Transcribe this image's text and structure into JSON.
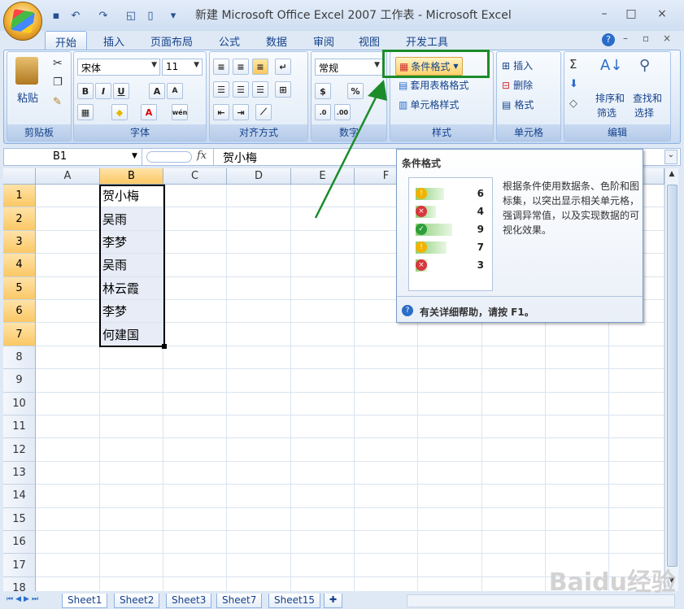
{
  "window": {
    "title": "新建 Microsoft Office Excel 2007 工作表 - Microsoft Excel",
    "controls": [
      "–",
      "□",
      "×"
    ]
  },
  "tabs": [
    {
      "label": "开始",
      "active": true
    },
    {
      "label": "插入"
    },
    {
      "label": "页面布局"
    },
    {
      "label": "公式"
    },
    {
      "label": "数据"
    },
    {
      "label": "审阅"
    },
    {
      "label": "视图"
    },
    {
      "label": "开发工具"
    }
  ],
  "ribbon": {
    "clipboard": {
      "label": "剪贴板",
      "paste": "粘贴"
    },
    "font": {
      "label": "字体",
      "name": "宋体",
      "size": "11"
    },
    "alignment": {
      "label": "对齐方式"
    },
    "number": {
      "label": "数字",
      "format": "常规"
    },
    "styles": {
      "label": "样式",
      "conditional": "条件格式",
      "table": "套用表格格式",
      "cell": "单元格样式"
    },
    "cells": {
      "label": "单元格",
      "insert": "插入",
      "delete": "删除",
      "format": "格式"
    },
    "editing": {
      "label": "编辑",
      "sort1": "排序和",
      "sort2": "筛选",
      "find1": "查找和",
      "find2": "选择"
    }
  },
  "formula_bar": {
    "name_box": "B1",
    "fx": "fx",
    "value": "贺小梅"
  },
  "columns": [
    "A",
    "B",
    "C",
    "D",
    "E",
    "F"
  ],
  "rows": [
    "1",
    "2",
    "3",
    "4",
    "5",
    "6",
    "7",
    "8",
    "9",
    "10",
    "11",
    "12",
    "13",
    "14",
    "15",
    "16",
    "17",
    "18"
  ],
  "cells_b": [
    "贺小梅",
    "吴雨",
    "李梦",
    "吴雨",
    "林云霞",
    "李梦",
    "何建国"
  ],
  "tooltip": {
    "title": "条件格式",
    "description": "根据条件使用数据条、色阶和图标集，以突出显示相关单元格，强调异常值，以及实现数据的可视化效果。",
    "sample_values": [
      "6",
      "4",
      "9",
      "7",
      "3"
    ],
    "help": "有关详细帮助，请按 F1。"
  },
  "sheets": [
    "Sheet1",
    "Sheet2",
    "Sheet3",
    "Sheet7",
    "Sheet15"
  ],
  "watermark": "Baidu经验",
  "colors": {
    "accent": "#1c8c2b",
    "selection": "#fbc865"
  }
}
